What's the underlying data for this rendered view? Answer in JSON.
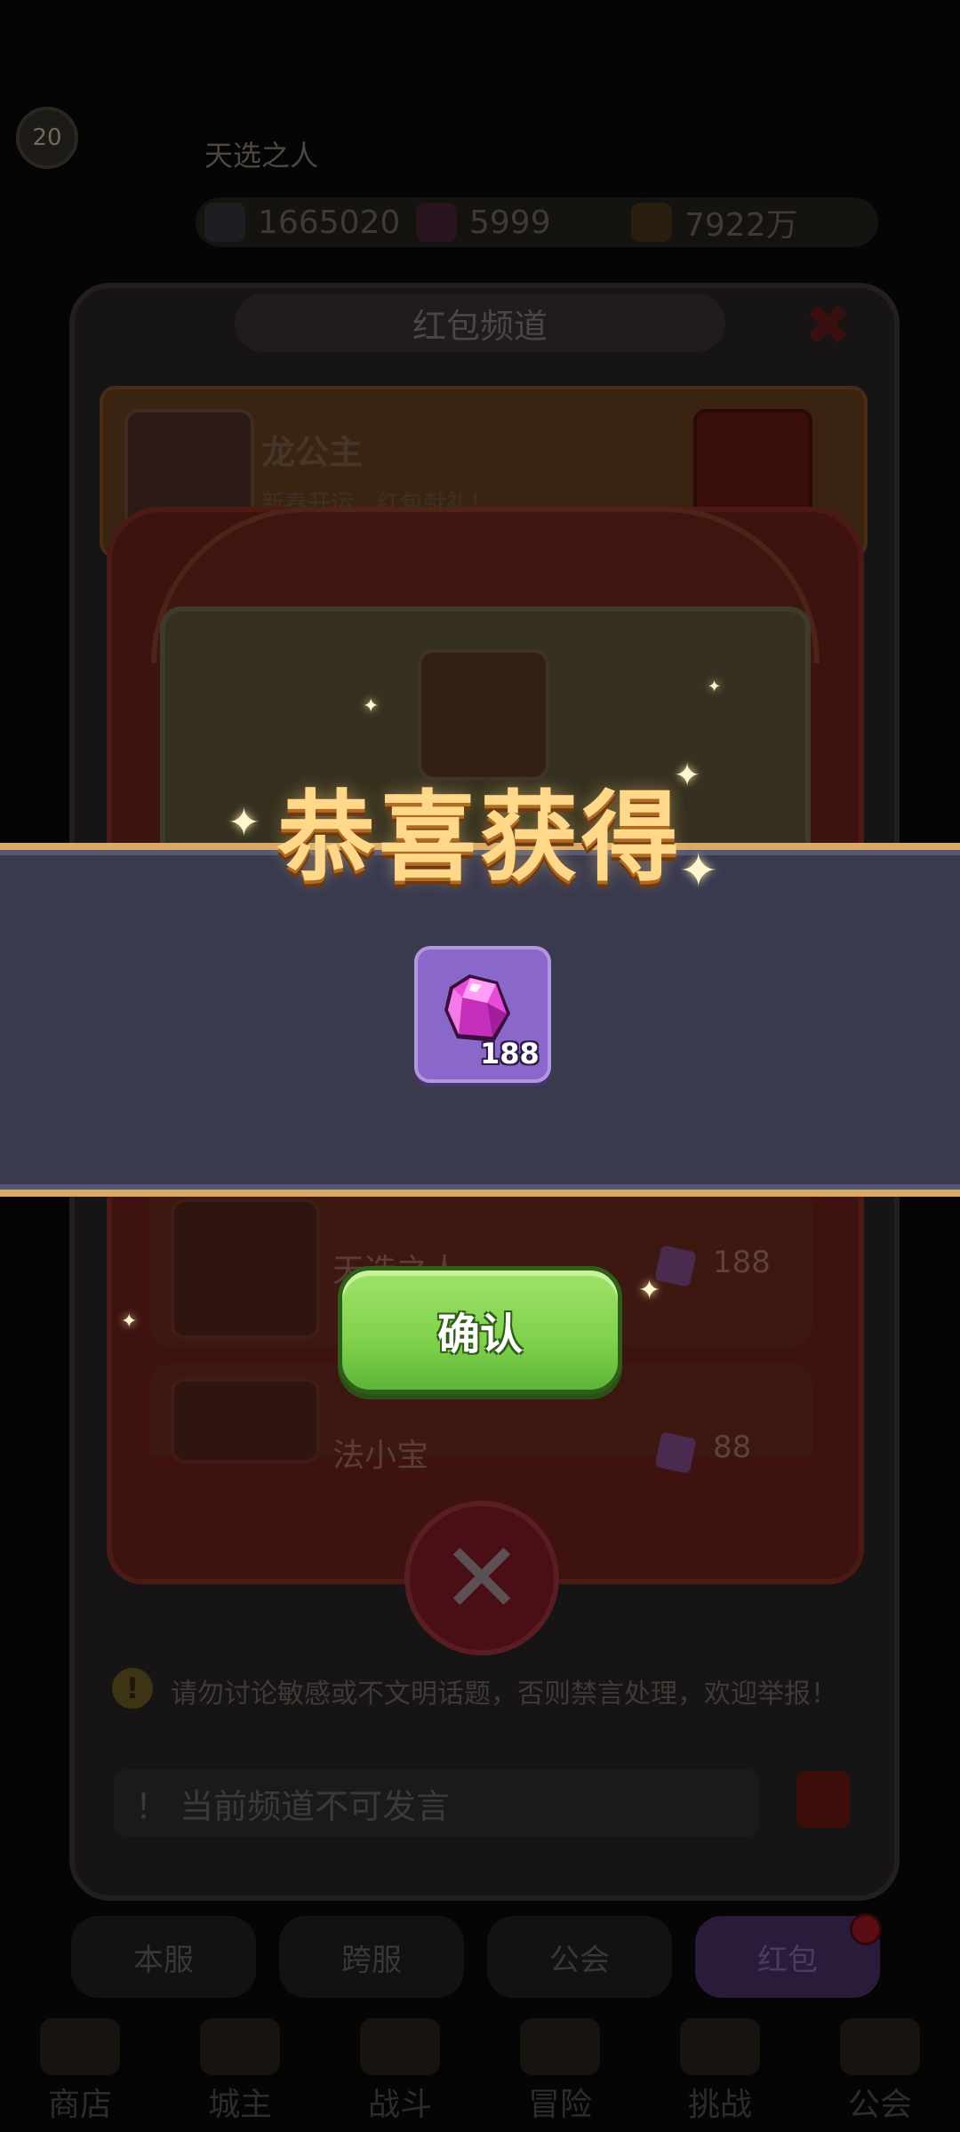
{
  "hud": {
    "level": "20",
    "player_name": "天选之人",
    "power": "1665020",
    "gems": "5999",
    "gold": "7922万"
  },
  "channel": {
    "title": "红包频道",
    "message": {
      "sender": "龙公主",
      "text": "新春开运，红包献礼！"
    },
    "warning": "请勿讨论敏感或不文明话题，否则禁言处理，欢迎举报！",
    "input_placeholder": "！ 当前频道不可发言"
  },
  "packet_list": [
    {
      "name": "天选之人",
      "value": "188"
    },
    {
      "name": "法小宝",
      "value": "88"
    }
  ],
  "reward_popup": {
    "title": "恭喜获得",
    "item": {
      "icon": "purple-gem-icon",
      "count": "188"
    },
    "confirm_label": "确认"
  },
  "chat_tabs": [
    "本服",
    "跨服",
    "公会",
    "红包"
  ],
  "nav": [
    "商店",
    "城主",
    "战斗",
    "冒险",
    "挑战",
    "公会"
  ],
  "colors": {
    "banner_bg": "#3a3a4f",
    "banner_border": "#d9a968",
    "title_gold": "#ffd88a",
    "confirm_green": "#7fd14a",
    "gem_purple": "#8a68c9"
  }
}
